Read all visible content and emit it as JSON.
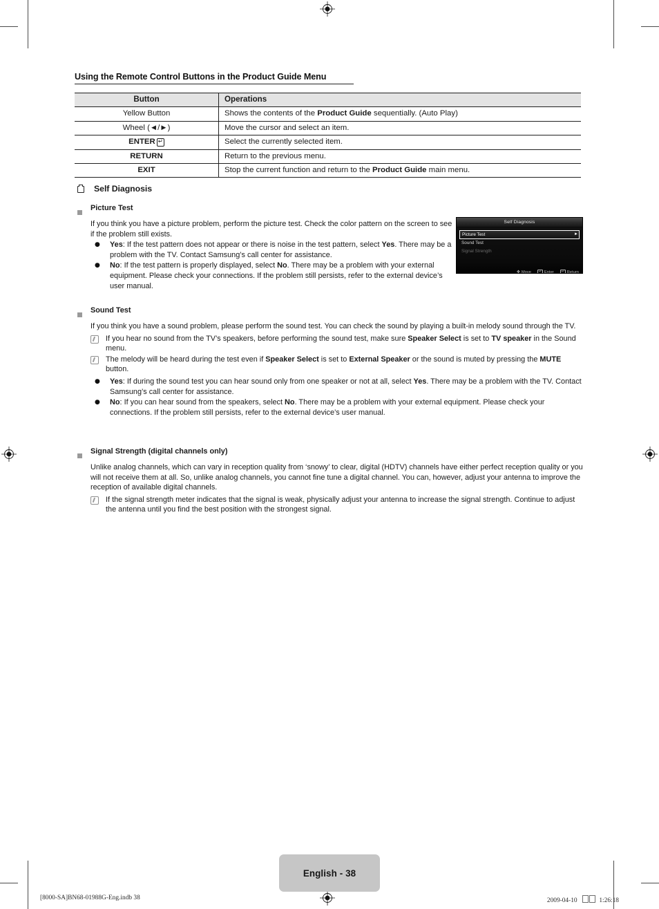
{
  "document": {
    "section_heading": "Using the Remote Control Buttons in the Product Guide Menu",
    "page_label": "English - 38",
    "footer_left": "[8000-SA]BN68-01988G-Eng.indb   38",
    "footer_right_date": "2009-04-10",
    "footer_right_time": "1:26:18"
  },
  "table": {
    "headers": [
      "Button",
      "Operations"
    ],
    "rows": [
      {
        "button": "Yellow Button",
        "button_bold": false,
        "ops_parts": [
          {
            "t": "Shows the contents of the ",
            "b": false
          },
          {
            "t": "Product Guide",
            "b": true
          },
          {
            "t": " sequentially. (Auto Play)",
            "b": false
          }
        ]
      },
      {
        "button": "Wheel (◄/►)",
        "button_bold": false,
        "ops_parts": [
          {
            "t": "Move the cursor and select an item.",
            "b": false
          }
        ]
      },
      {
        "button": "ENTER",
        "button_bold": true,
        "button_glyph": "↵",
        "ops_parts": [
          {
            "t": "Select the currently selected item.",
            "b": false
          }
        ]
      },
      {
        "button": "RETURN",
        "button_bold": true,
        "ops_parts": [
          {
            "t": "Return to the previous menu.",
            "b": false
          }
        ]
      },
      {
        "button": "EXIT",
        "button_bold": true,
        "ops_parts": [
          {
            "t": "Stop the current function and return to the ",
            "b": false
          },
          {
            "t": "Product Guide",
            "b": true
          },
          {
            "t": " main menu.",
            "b": false
          }
        ]
      }
    ]
  },
  "self_diagnosis": {
    "title": "Self Diagnosis",
    "picture_test": {
      "title": "Picture Test",
      "intro": "If you think you have a picture problem, perform the picture test. Check the color pattern on the screen to see if the problem still exists.",
      "bullets": [
        [
          {
            "t": "Yes",
            "b": true
          },
          {
            "t": ": If the test pattern does not appear or there is noise in the test pattern, select ",
            "b": false
          },
          {
            "t": "Yes",
            "b": true
          },
          {
            "t": ". There may be a problem with the TV. Contact Samsung’s call center for assistance.",
            "b": false
          }
        ],
        [
          {
            "t": "No",
            "b": true
          },
          {
            "t": ": If the test pattern is properly displayed, select ",
            "b": false
          },
          {
            "t": "No",
            "b": true
          },
          {
            "t": ". There may be a problem with your external equipment. Please check your connections. If the problem still persists, refer to the external device’s user manual.",
            "b": false
          }
        ]
      ]
    },
    "sound_test": {
      "title": "Sound Test",
      "intro": "If you think you have a sound problem, please perform the sound test. You can check the sound by playing a built-in melody sound through the TV.",
      "notes": [
        [
          {
            "t": "If you hear no sound from the TV’s speakers, before performing the sound test, make sure ",
            "b": false
          },
          {
            "t": "Speaker Select",
            "b": true
          },
          {
            "t": " is set to ",
            "b": false
          },
          {
            "t": "TV speaker",
            "b": true
          },
          {
            "t": " in the Sound menu.",
            "b": false
          }
        ],
        [
          {
            "t": "The melody will be heard during the test even if ",
            "b": false
          },
          {
            "t": "Speaker Select",
            "b": true
          },
          {
            "t": " is set to ",
            "b": false
          },
          {
            "t": "External Speaker",
            "b": true
          },
          {
            "t": " or the sound is muted by pressing the ",
            "b": false
          },
          {
            "t": "MUTE",
            "b": true
          },
          {
            "t": " button.",
            "b": false
          }
        ]
      ],
      "bullets": [
        [
          {
            "t": "Yes",
            "b": true
          },
          {
            "t": ": If during the sound test you can hear sound only from one speaker or not at all, select ",
            "b": false
          },
          {
            "t": "Yes",
            "b": true
          },
          {
            "t": ". There may be a problem with the TV. Contact Samsung’s call center for assistance.",
            "b": false
          }
        ],
        [
          {
            "t": "No",
            "b": true
          },
          {
            "t": ": If you can hear sound from the speakers, select ",
            "b": false
          },
          {
            "t": "No",
            "b": true
          },
          {
            "t": ". There may be a problem with your external equipment. Please check your connections. If the problem still persists, refer to the external device’s user manual.",
            "b": false
          }
        ]
      ]
    },
    "signal_strength": {
      "title": "Signal Strength (digital channels only)",
      "intro": "Unlike analog channels, which can vary in reception quality from ‘snowy’ to clear, digital (HDTV) channels have either perfect reception quality or you will not receive them at all. So, unlike analog channels, you cannot fine tune a digital channel. You can, however, adjust your antenna to improve the reception of available digital channels.",
      "notes": [
        [
          {
            "t": "If the signal strength meter indicates that the signal is weak, physically adjust your antenna to increase the signal strength. Continue to adjust the antenna until you find the best position with the strongest signal.",
            "b": false
          }
        ]
      ]
    }
  },
  "osd": {
    "title": "Self Diagnosis",
    "items": [
      {
        "label": "Picture Test",
        "state": "selected",
        "arrow": "►"
      },
      {
        "label": "Sound Test",
        "state": "normal",
        "arrow": ""
      },
      {
        "label": "Signal Strength",
        "state": "disabled",
        "arrow": ""
      }
    ],
    "footer": [
      {
        "glyph": "✥",
        "label": "Move"
      },
      {
        "glyph": "↵",
        "label": "Enter"
      },
      {
        "glyph": "↩",
        "label": "Return"
      }
    ]
  }
}
